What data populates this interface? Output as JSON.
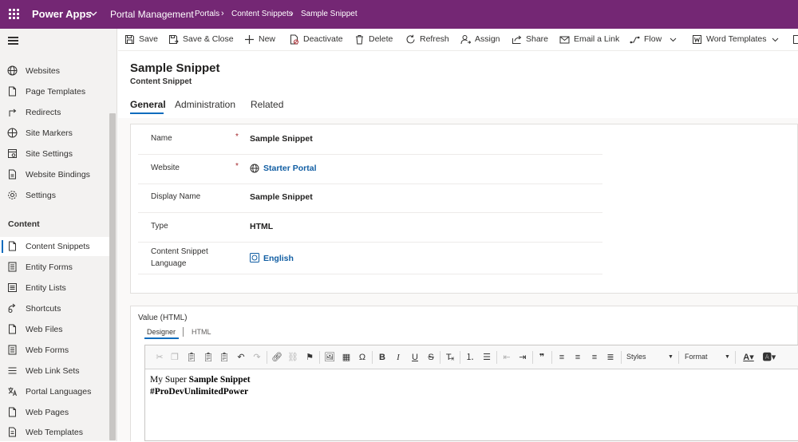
{
  "topbar": {
    "app_name": "Power Apps",
    "module": "Portal Management",
    "breadcrumb": [
      "Portals",
      "Content Snippets",
      "Sample Snippet"
    ]
  },
  "sidebar": {
    "items_top": [
      {
        "label": "Websites",
        "icon": "globe-icon"
      },
      {
        "label": "Page Templates",
        "icon": "page-icon"
      },
      {
        "label": "Redirects",
        "icon": "redirect-icon"
      },
      {
        "label": "Site Markers",
        "icon": "site-marker-icon"
      },
      {
        "label": "Site Settings",
        "icon": "site-settings-icon"
      },
      {
        "label": "Website Bindings",
        "icon": "binding-icon"
      },
      {
        "label": "Settings",
        "icon": "gear-icon"
      }
    ],
    "section_label": "Content",
    "items_content": [
      {
        "label": "Content Snippets",
        "icon": "document-icon",
        "active": true
      },
      {
        "label": "Entity Forms",
        "icon": "form-icon"
      },
      {
        "label": "Entity Lists",
        "icon": "list-icon"
      },
      {
        "label": "Shortcuts",
        "icon": "shortcut-icon"
      },
      {
        "label": "Web Files",
        "icon": "file-icon"
      },
      {
        "label": "Web Forms",
        "icon": "form-icon"
      },
      {
        "label": "Web Link Sets",
        "icon": "list-icon"
      },
      {
        "label": "Portal Languages",
        "icon": "language-icon"
      },
      {
        "label": "Web Pages",
        "icon": "page-icon"
      },
      {
        "label": "Web Templates",
        "icon": "template-icon"
      }
    ]
  },
  "commands": {
    "save": "Save",
    "save_close": "Save & Close",
    "new": "New",
    "deactivate": "Deactivate",
    "delete": "Delete",
    "refresh": "Refresh",
    "assign": "Assign",
    "share": "Share",
    "email_link": "Email a Link",
    "flow": "Flow",
    "word_templates": "Word Templates"
  },
  "record": {
    "title": "Sample Snippet",
    "entity": "Content Snippet"
  },
  "tabs": [
    "General",
    "Administration",
    "Related"
  ],
  "fields": {
    "name_label": "Name",
    "name_value": "Sample Snippet",
    "website_label": "Website",
    "website_value": "Starter Portal",
    "display_name_label": "Display Name",
    "display_name_value": "Sample Snippet",
    "type_label": "Type",
    "type_value": "HTML",
    "language_label_1": "Content Snippet",
    "language_label_2": "Language",
    "language_value": "English",
    "required_mark": "*"
  },
  "editor": {
    "value_label": "Value (HTML)",
    "tab_designer": "Designer",
    "tab_html": "HTML",
    "styles_label": "Styles",
    "format_label": "Format",
    "line1_normal": "My Super ",
    "line1_bold": "Sample Snippet",
    "line2_bold": "#ProDevUnlimitedPower"
  },
  "colors": {
    "brand": "#742774",
    "accent": "#0f6cbd",
    "link": "#115ea3",
    "required": "#a4262c"
  }
}
